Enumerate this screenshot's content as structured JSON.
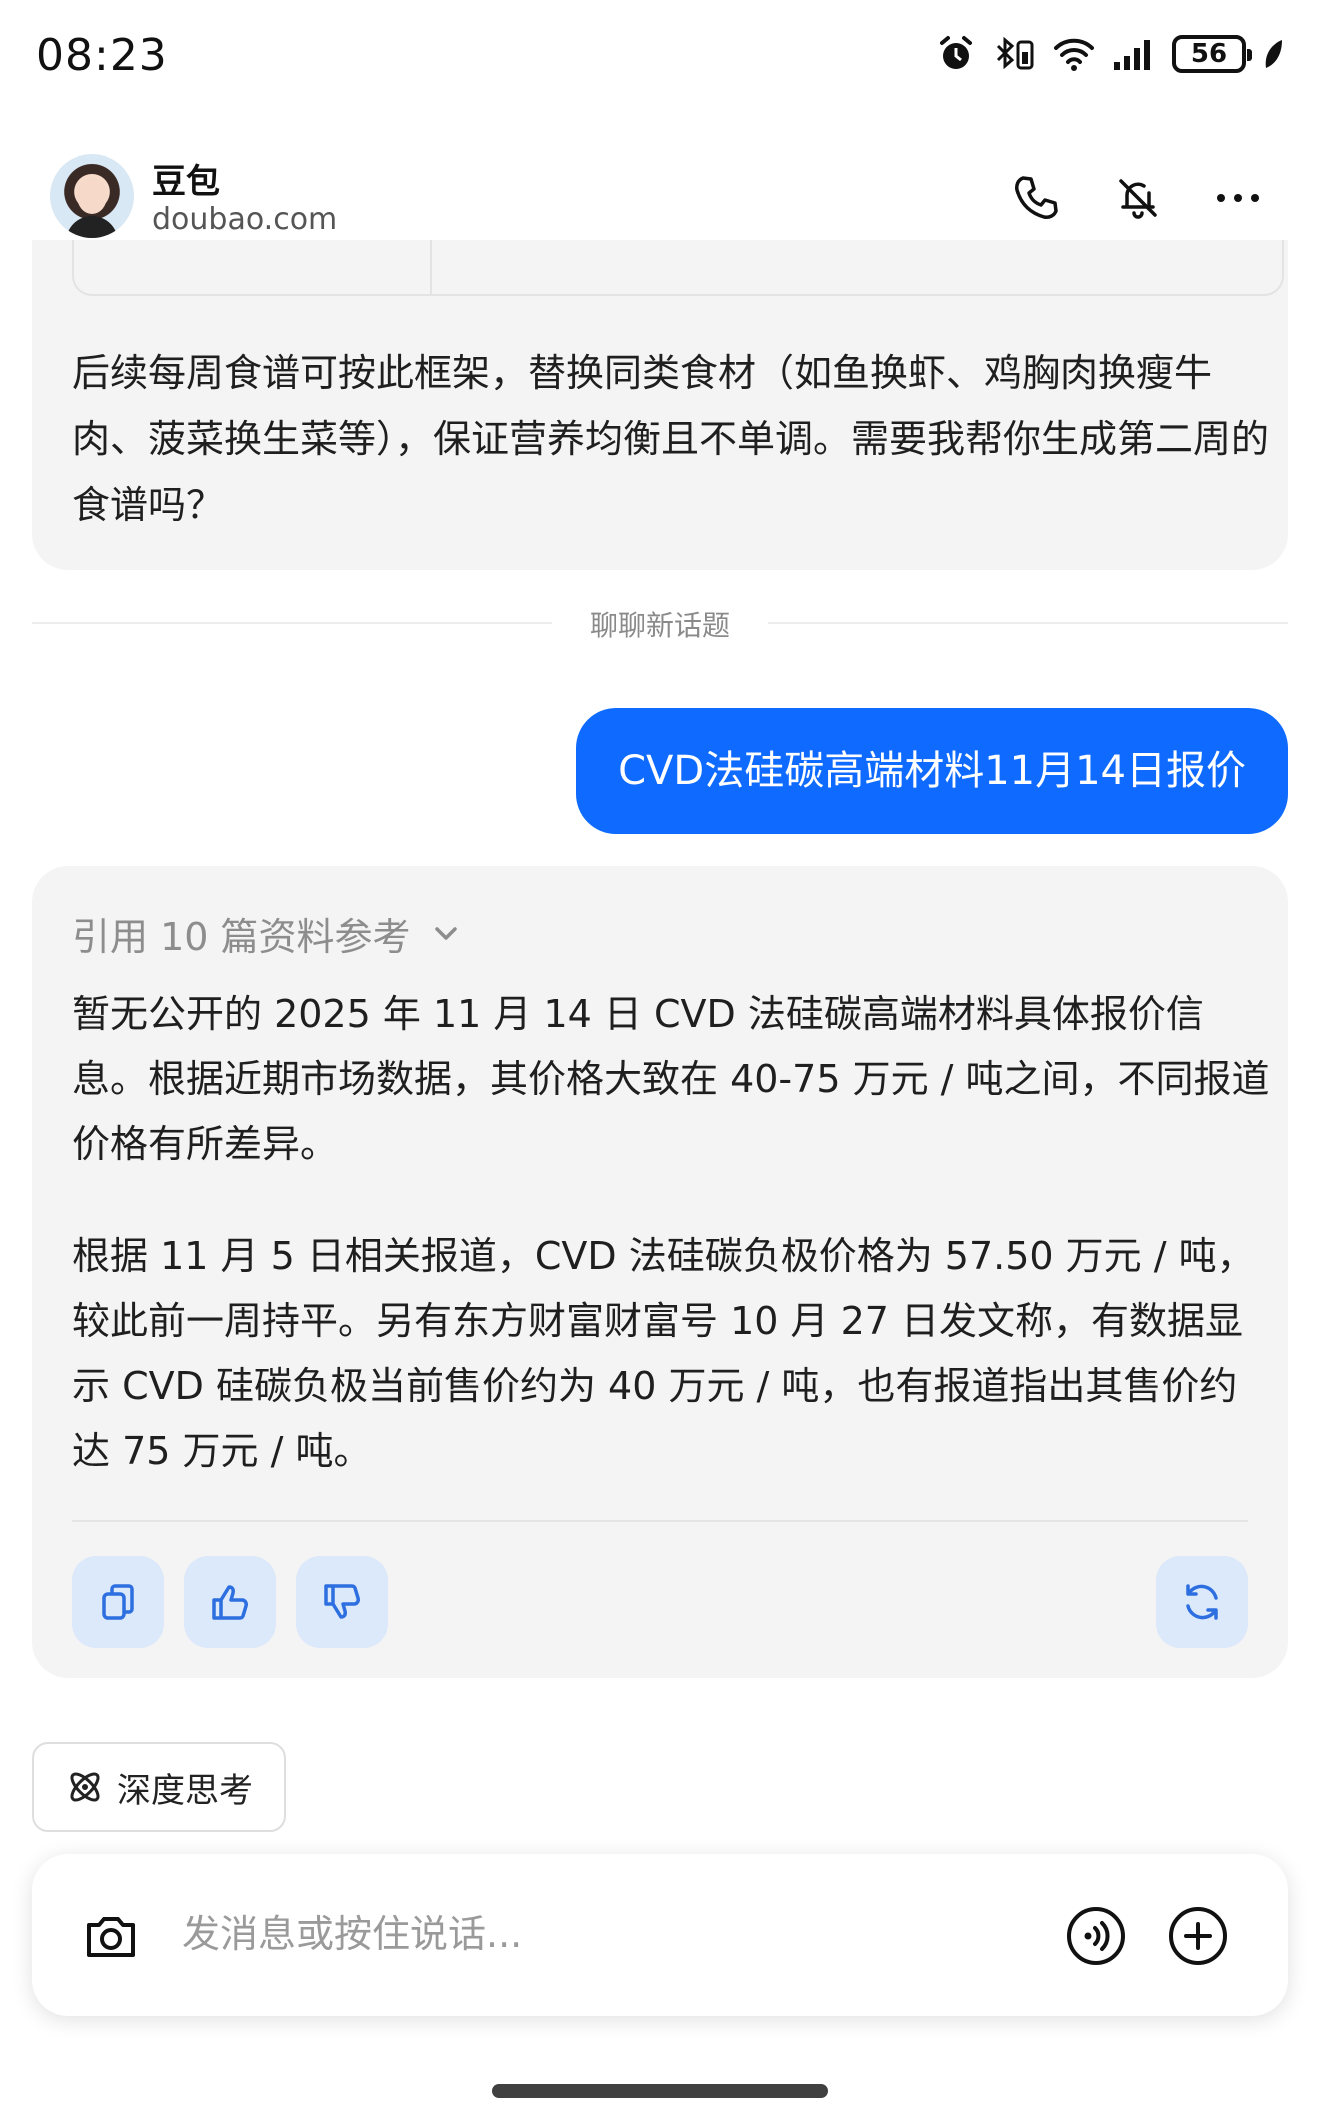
{
  "status_bar": {
    "time": "08:23",
    "battery": "56"
  },
  "header": {
    "app_name": "豆包",
    "domain": "doubao.com"
  },
  "conversation": {
    "previous_reply_tail": "后续每周食谱可按此框架，替换同类食材（如鱼换虾、鸡胸肉换瘦牛肉、菠菜换生菜等），保证营养均衡且不单调。需要我帮你生成第二周的食谱吗？",
    "divider_label": "聊聊新话题",
    "user_message": "CVD法硅碳高端材料11月14日报价",
    "ai_reply": {
      "references_label": "引用 10 篇资料参考",
      "paragraph_1": "暂无公开的 2025 年 11 月 14 日 CVD 法硅碳高端材料具体报价信息。根据近期市场数据，其价格大致在 40-75 万元 / 吨之间，不同报道价格有所差异。",
      "paragraph_2": "根据 11 月 5 日相关报道，CVD 法硅碳负极价格为 57.50 万元 / 吨，较此前一周持平。另有东方财富财富号 10 月 27 日发文称，有数据显示 CVD 硅碳负极当前售价约为 40 万元 / 吨，也有报道指出其售价约达 75 万元 / 吨。"
    }
  },
  "deep_think_label": "深度思考",
  "composer": {
    "placeholder": "发消息或按住说话..."
  },
  "colors": {
    "accent": "#0f6bff",
    "card_bg": "#f4f4f4",
    "action_button_bg": "#dce9fb"
  }
}
